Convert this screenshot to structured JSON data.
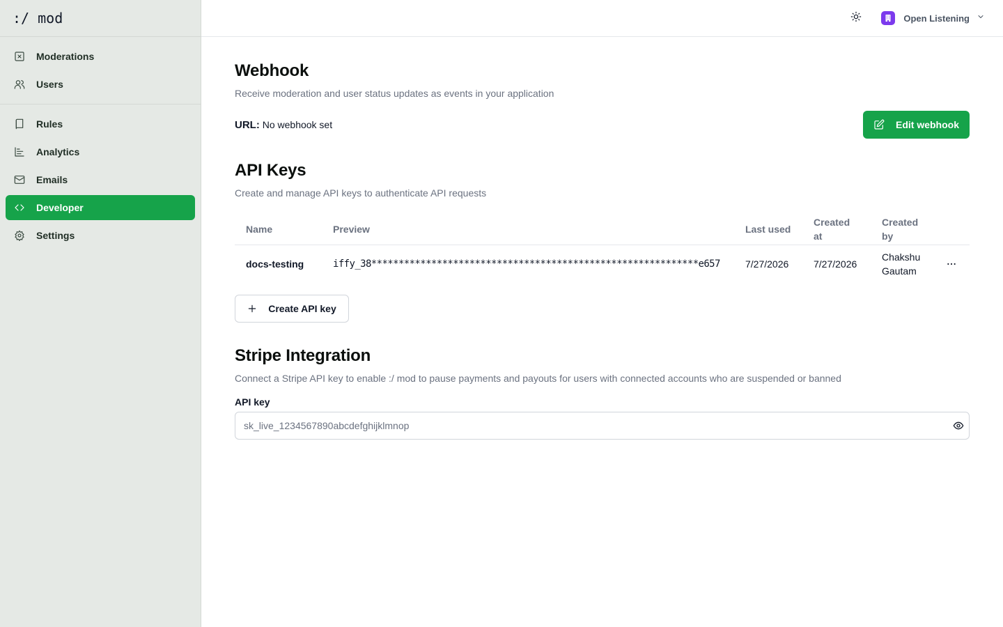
{
  "app": {
    "logo": ":/ mod"
  },
  "sidebar": {
    "primary": [
      {
        "label": "Moderations",
        "icon": "flag-square-icon"
      },
      {
        "label": "Users",
        "icon": "users-icon"
      }
    ],
    "secondary": [
      {
        "label": "Rules",
        "icon": "book-icon"
      },
      {
        "label": "Analytics",
        "icon": "chart-icon"
      },
      {
        "label": "Emails",
        "icon": "mail-icon"
      },
      {
        "label": "Developer",
        "icon": "code-icon",
        "active": true
      },
      {
        "label": "Settings",
        "icon": "gear-icon"
      }
    ]
  },
  "topbar": {
    "theme_icon": "sun-icon",
    "org_name": "Open Listening",
    "org_avatar_color": "#7c3aed"
  },
  "webhook": {
    "title": "Webhook",
    "description": "Receive moderation and user status updates as events in your application",
    "url_label": "URL:",
    "url_value": "No webhook set",
    "edit_button": "Edit webhook"
  },
  "api_keys": {
    "title": "API Keys",
    "description": "Create and manage API keys to authenticate API requests",
    "columns": {
      "name": "Name",
      "preview": "Preview",
      "last_used": "Last used",
      "created_at": "Created at",
      "created_by": "Created by"
    },
    "rows": [
      {
        "name": "docs-testing",
        "preview": "iffy_38************************************************************e657",
        "last_used": "7/27/2026",
        "created_at": "7/27/2026",
        "created_by": "Chakshu Gautam"
      }
    ],
    "create_button": "Create API key"
  },
  "stripe": {
    "title": "Stripe Integration",
    "description": "Connect a Stripe API key to enable :/ mod to pause payments and payouts for users with connected accounts who are suspended or banned",
    "field_label": "API key",
    "field_value": "sk_live_1234567890abcdefghijklmnop"
  },
  "colors": {
    "accent": "#16a34a",
    "sidebar_bg": "#e5e9e5"
  }
}
